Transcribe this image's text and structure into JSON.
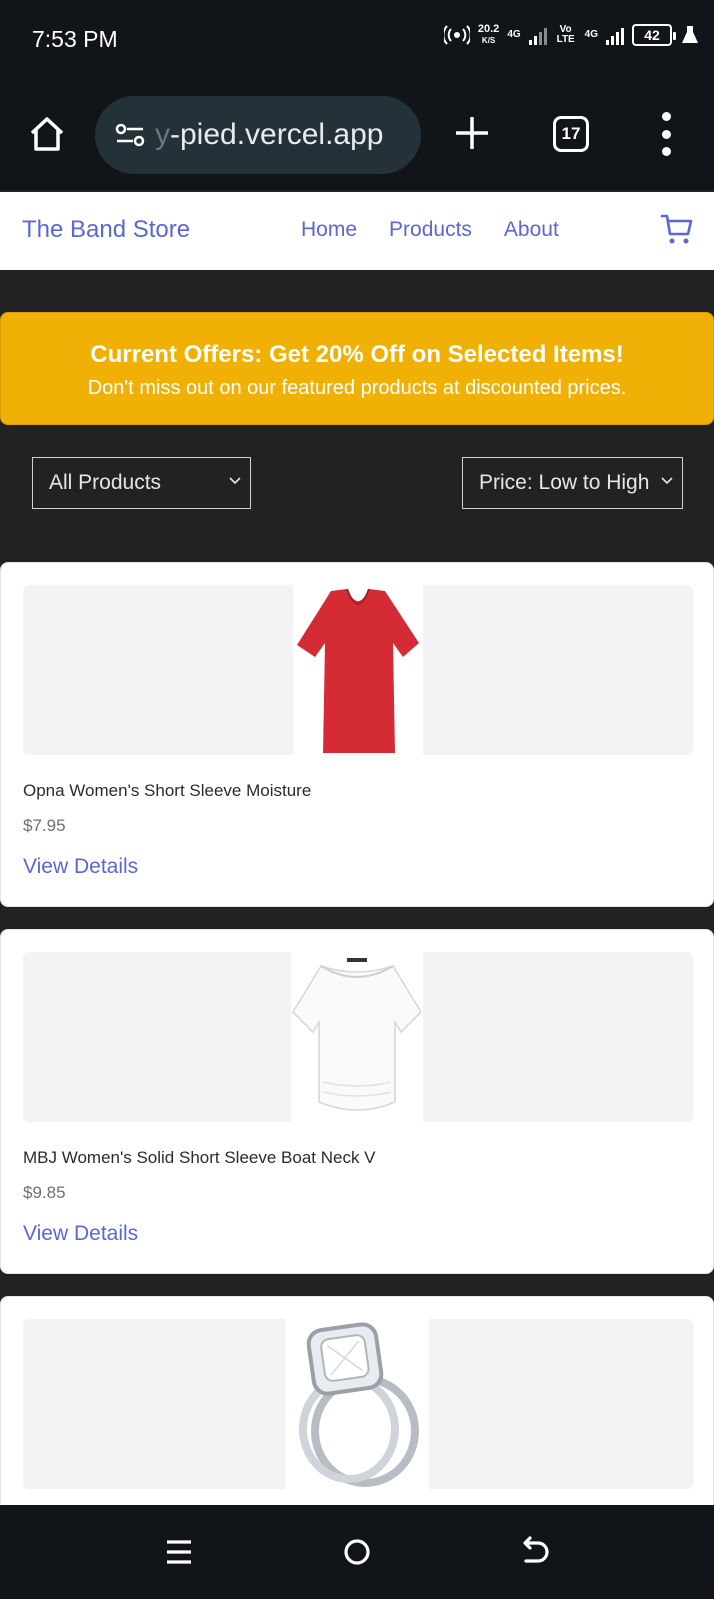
{
  "status_bar": {
    "time": "7:53 PM",
    "net_speed": "20.2",
    "net_unit": "K/S",
    "sim1": "4G",
    "volte": "Vo LTE",
    "sim2": "4G",
    "battery": "42"
  },
  "browser": {
    "url_fade": "y",
    "url": "-pied.vercel.app",
    "tab_count": "17",
    "icons": [
      "home-icon",
      "tune-icon",
      "plus-icon",
      "tabs-icon",
      "more-vert-icon"
    ]
  },
  "site": {
    "brand": "The Band Store",
    "nav": [
      "Home",
      "Products",
      "About"
    ],
    "brand_color": "#5a67d8"
  },
  "offer": {
    "title": "Current Offers: Get 20% Off on Selected Items!",
    "subtitle": "Don't miss out on our featured products at discounted prices.",
    "color": "#f0b005"
  },
  "filters": {
    "category": "All Products",
    "sort": "Price: Low to High"
  },
  "products": [
    {
      "name": "Opna Women's Short Sleeve Moisture",
      "price": "$7.95",
      "link": "View Details",
      "image": "red-tshirt-image"
    },
    {
      "name": "MBJ Women's Solid Short Sleeve Boat Neck V",
      "price": "$9.85",
      "link": "View Details",
      "image": "white-top-image"
    },
    {
      "name": "",
      "price": "",
      "link": "",
      "image": "diamond-ring-image"
    }
  ],
  "bottom_nav": [
    "menu-icon",
    "home-circle-icon",
    "back-icon"
  ]
}
